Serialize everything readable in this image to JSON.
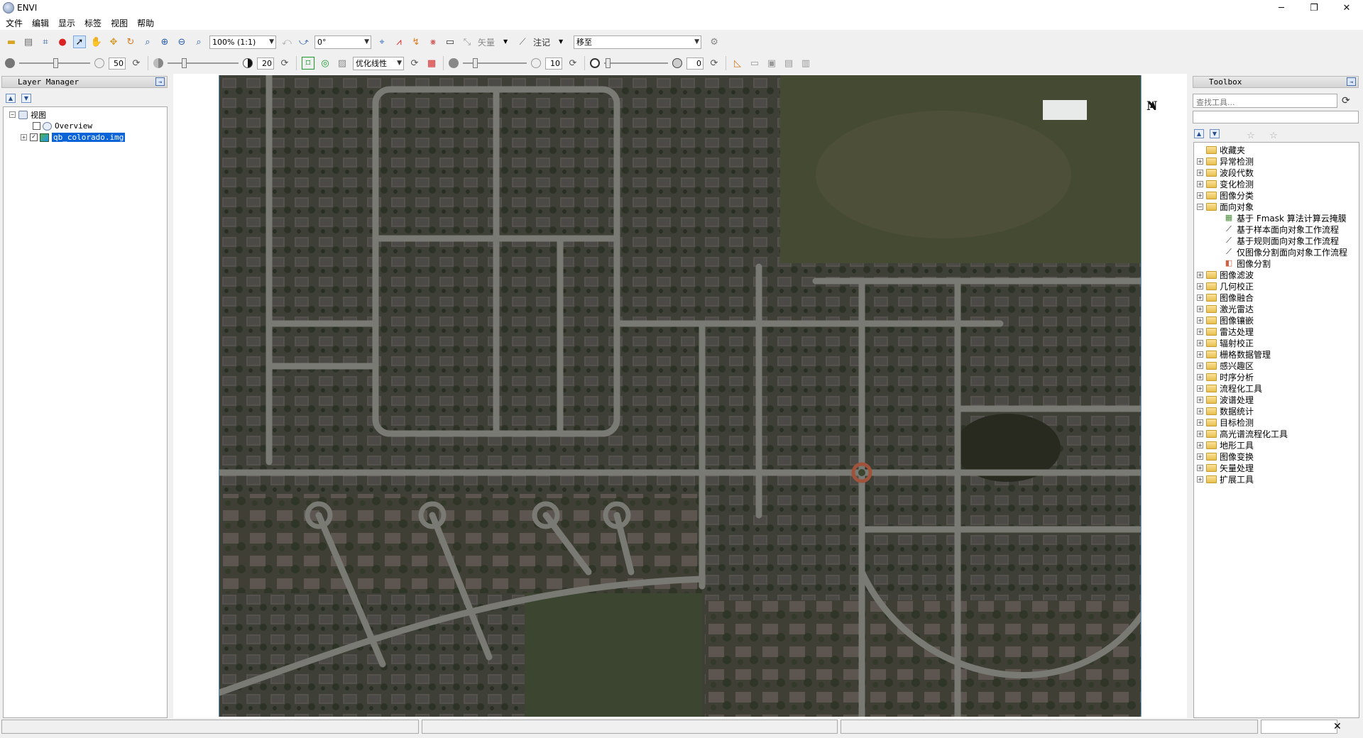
{
  "window": {
    "title": "ENVI",
    "controls": [
      "─",
      "❐",
      "✕"
    ]
  },
  "menu": [
    "文件",
    "编辑",
    "显示",
    "标签",
    "视图",
    "帮助"
  ],
  "toolbar1": {
    "zoom_value": "100% (1:1)",
    "rotation_value": "0°",
    "vector_label": "矢量",
    "annotation_label": "注记",
    "goto_placeholder": "移至"
  },
  "toolbar2": {
    "brightness_value": "50",
    "contrast_value": "20",
    "stretch_value": "优化线性",
    "sharpen_value": "10",
    "transparency_value": "0"
  },
  "layer_manager": {
    "title": "Layer Manager",
    "root": "视图",
    "items": [
      "Overview",
      "qb_colorado.img"
    ]
  },
  "toolbox": {
    "title": "Toolbox",
    "search_placeholder": "查找工具...",
    "favorites": "收藏夹",
    "folders_before": [
      "异常检测",
      "波段代数",
      "变化检测",
      "图像分类"
    ],
    "open_folder": "面向对象",
    "open_children": [
      {
        "label": "基于 Fmask 算法计算云掩膜",
        "icon": "mask-icon"
      },
      {
        "label": "基于样本面向对象工作流程",
        "icon": "wand-icon"
      },
      {
        "label": "基于规则面向对象工作流程",
        "icon": "wand-icon"
      },
      {
        "label": "仅图像分割面向对象工作流程",
        "icon": "wand-icon"
      },
      {
        "label": "图像分割",
        "icon": "segment-icon"
      }
    ],
    "folders_after": [
      "图像滤波",
      "几何校正",
      "图像融合",
      "激光雷达",
      "图像镶嵌",
      "雷达处理",
      "辐射校正",
      "栅格数据管理",
      "感兴趣区",
      "时序分析",
      "流程化工具",
      "波谱处理",
      "数据统计",
      "目标检测",
      "高光谱流程化工具",
      "地形工具",
      "图像变换",
      "矢量处理",
      "扩展工具"
    ]
  },
  "map": {
    "north_label": "N"
  }
}
